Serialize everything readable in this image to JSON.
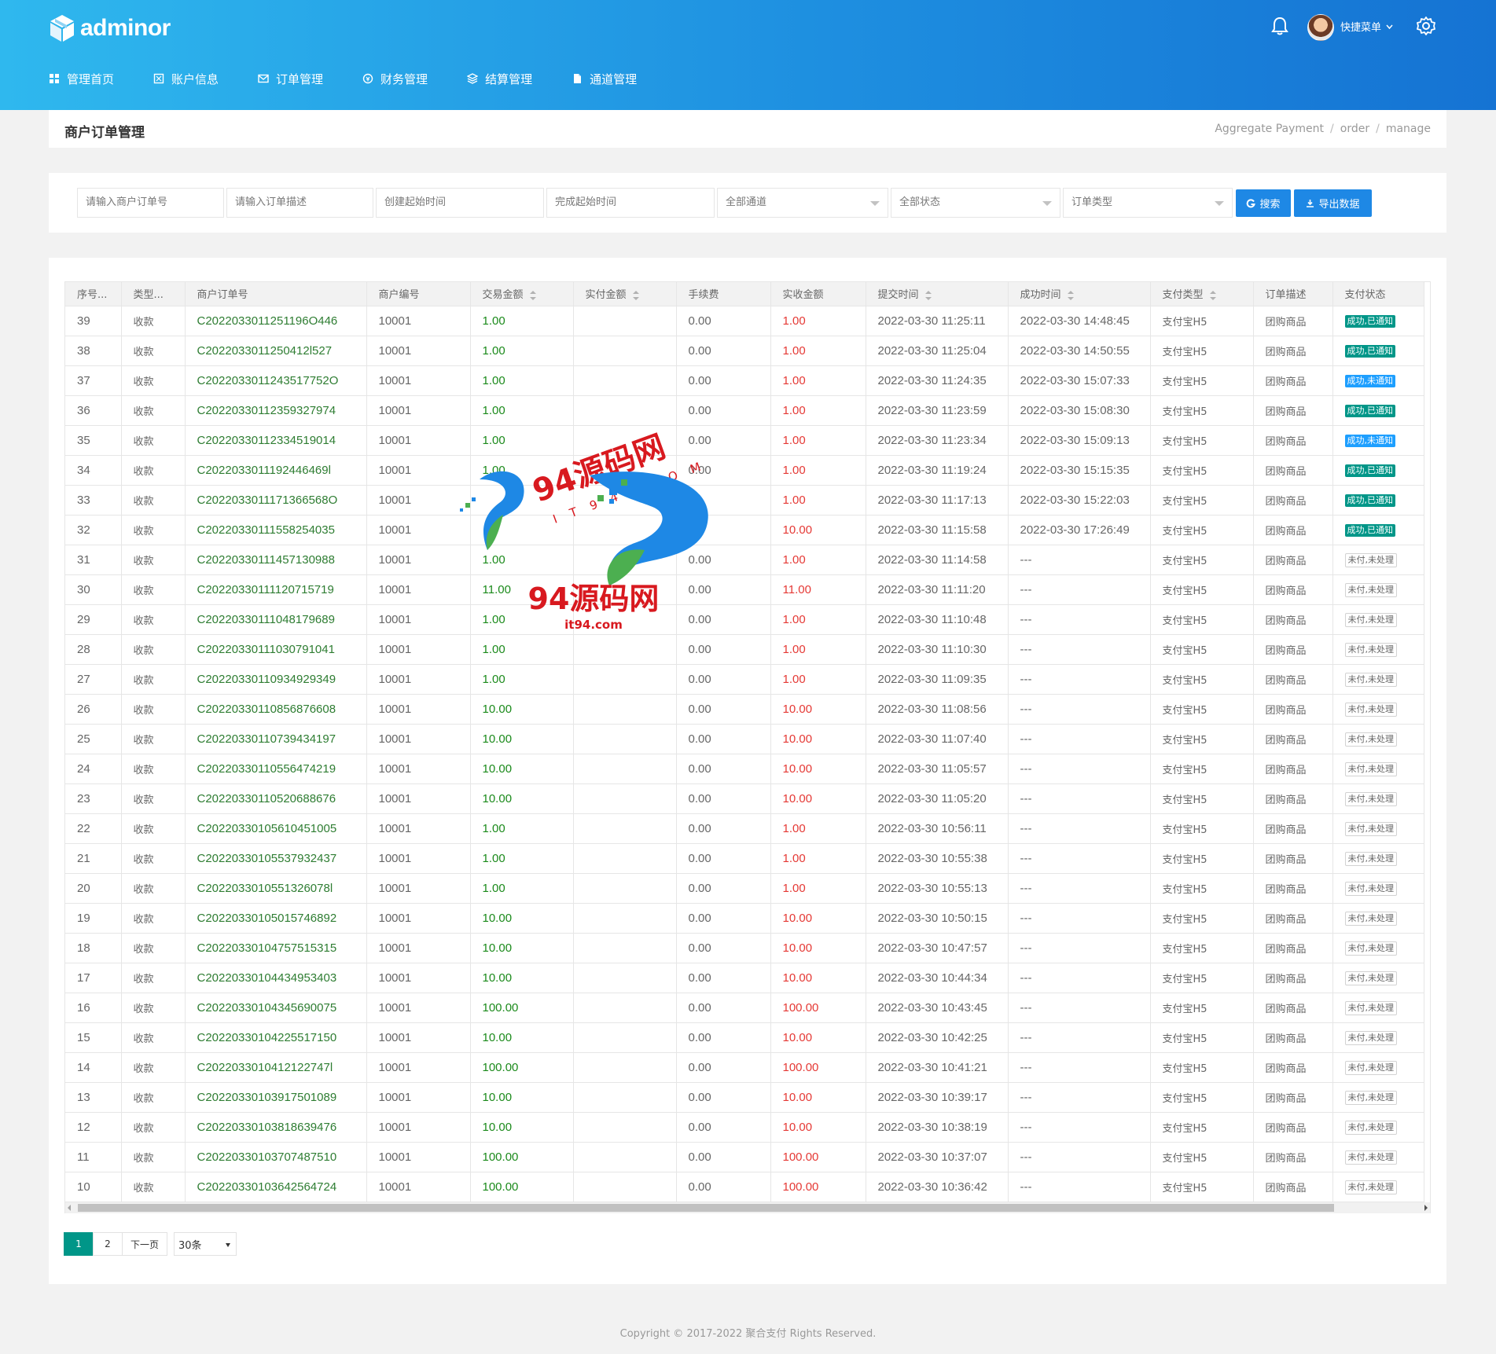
{
  "header": {
    "logo_text": "adminor",
    "quick_menu": "快捷菜单",
    "nav": [
      {
        "label": "管理首页",
        "icon": "grid-icon"
      },
      {
        "label": "账户信息",
        "icon": "account-icon"
      },
      {
        "label": "订单管理",
        "icon": "mail-icon"
      },
      {
        "label": "财务管理",
        "icon": "finance-icon"
      },
      {
        "label": "结算管理",
        "icon": "layers-icon"
      },
      {
        "label": "通道管理",
        "icon": "document-icon"
      }
    ]
  },
  "page": {
    "title": "商户订单管理",
    "breadcrumb": [
      "Aggregate Payment",
      "order",
      "manage"
    ]
  },
  "filters": {
    "order_no_placeholder": "请输入商户订单号",
    "desc_placeholder": "请输入订单描述",
    "create_time_placeholder": "创建起始时间",
    "finish_time_placeholder": "完成起始时间",
    "channel": "全部通道",
    "status": "全部状态",
    "order_type": "订单类型",
    "search_label": "搜索",
    "export_label": "导出数据"
  },
  "table": {
    "headers": [
      "序号...",
      "类型...",
      "商户订单号",
      "商户编号",
      "交易金额",
      "实付金额",
      "手续费",
      "实收金额",
      "提交时间",
      "成功时间",
      "支付类型",
      "订单描述",
      "支付状态"
    ],
    "rows": [
      {
        "id": "39",
        "type": "收款",
        "order": "C2022033011251196O446",
        "merchant": "10001",
        "amount": "1.00",
        "paid": "",
        "fee": "0.00",
        "received": "1.00",
        "submit": "2022-03-30 11:25:11",
        "success": "2022-03-30 14:48:45",
        "pay_type": "支付宝H5",
        "desc": "团购商品",
        "status": "成功,已通知",
        "st": "ok"
      },
      {
        "id": "38",
        "type": "收款",
        "order": "C2022033011250412l527",
        "merchant": "10001",
        "amount": "1.00",
        "paid": "",
        "fee": "0.00",
        "received": "1.00",
        "submit": "2022-03-30 11:25:04",
        "success": "2022-03-30 14:50:55",
        "pay_type": "支付宝H5",
        "desc": "团购商品",
        "status": "成功,已通知",
        "st": "ok"
      },
      {
        "id": "37",
        "type": "收款",
        "order": "C2022033011243517752O",
        "merchant": "10001",
        "amount": "1.00",
        "paid": "",
        "fee": "0.00",
        "received": "1.00",
        "submit": "2022-03-30 11:24:35",
        "success": "2022-03-30 15:07:33",
        "pay_type": "支付宝H5",
        "desc": "团购商品",
        "status": "成功,未通知",
        "st": "info"
      },
      {
        "id": "36",
        "type": "收款",
        "order": "C2022033011235932797​4",
        "merchant": "10001",
        "amount": "1.00",
        "paid": "",
        "fee": "0.00",
        "received": "1.00",
        "submit": "2022-03-30 11:23:59",
        "success": "2022-03-30 15:08:30",
        "pay_type": "支付宝H5",
        "desc": "团购商品",
        "status": "成功,已通知",
        "st": "ok"
      },
      {
        "id": "35",
        "type": "收款",
        "order": "C2022033011233451901​4",
        "merchant": "10001",
        "amount": "1.00",
        "paid": "",
        "fee": "0.00",
        "received": "1.00",
        "submit": "2022-03-30 11:23:34",
        "success": "2022-03-30 15:09:13",
        "pay_type": "支付宝H5",
        "desc": "团购商品",
        "status": "成功,未通知",
        "st": "info"
      },
      {
        "id": "34",
        "type": "收款",
        "order": "C2022033011192446469l",
        "merchant": "10001",
        "amount": "1.00",
        "paid": "",
        "fee": "0.00",
        "received": "1.00",
        "submit": "2022-03-30 11:19:24",
        "success": "2022-03-30 15:15:35",
        "pay_type": "支付宝H5",
        "desc": "团购商品",
        "status": "成功,已通知",
        "st": "ok"
      },
      {
        "id": "33",
        "type": "收款",
        "order": "C2022033011171366568O",
        "merchant": "10001",
        "amount": "",
        "paid": "",
        "fee": "",
        "received": "1.00",
        "submit": "2022-03-30 11:17:13",
        "success": "2022-03-30 15:22:03",
        "pay_type": "支付宝H5",
        "desc": "团购商品",
        "status": "成功,已通知",
        "st": "ok"
      },
      {
        "id": "32",
        "type": "收款",
        "order": "C2022033011155825403​5",
        "merchant": "10001",
        "amount": "",
        "paid": "",
        "fee": "",
        "received": "10.00",
        "submit": "2022-03-30 11:15:58",
        "success": "2022-03-30 17:26:49",
        "pay_type": "支付宝H5",
        "desc": "团购商品",
        "status": "成功,已通知",
        "st": "ok"
      },
      {
        "id": "31",
        "type": "收款",
        "order": "C2022033011145713098​8",
        "merchant": "10001",
        "amount": "1.00",
        "paid": "",
        "fee": "0.00",
        "received": "1.00",
        "submit": "2022-03-30 11:14:58",
        "success": "---",
        "pay_type": "支付宝H5",
        "desc": "团购商品",
        "status": "未付,未处理",
        "st": "pend"
      },
      {
        "id": "30",
        "type": "收款",
        "order": "C2022033011112071571​9",
        "merchant": "10001",
        "amount": "11.00",
        "paid": "",
        "fee": "0.00",
        "received": "11.00",
        "submit": "2022-03-30 11:11:20",
        "success": "---",
        "pay_type": "支付宝H5",
        "desc": "团购商品",
        "status": "未付,未处理",
        "st": "pend"
      },
      {
        "id": "29",
        "type": "收款",
        "order": "C2022033011104817968​9",
        "merchant": "10001",
        "amount": "1.00",
        "paid": "",
        "fee": "0.00",
        "received": "1.00",
        "submit": "2022-03-30 11:10:48",
        "success": "---",
        "pay_type": "支付宝H5",
        "desc": "团购商品",
        "status": "未付,未处理",
        "st": "pend"
      },
      {
        "id": "28",
        "type": "收款",
        "order": "C2022033011103079104​1",
        "merchant": "10001",
        "amount": "1.00",
        "paid": "",
        "fee": "0.00",
        "received": "1.00",
        "submit": "2022-03-30 11:10:30",
        "success": "---",
        "pay_type": "支付宝H5",
        "desc": "团购商品",
        "status": "未付,未处理",
        "st": "pend"
      },
      {
        "id": "27",
        "type": "收款",
        "order": "C2022033011093492934​9",
        "merchant": "10001",
        "amount": "1.00",
        "paid": "",
        "fee": "0.00",
        "received": "1.00",
        "submit": "2022-03-30 11:09:35",
        "success": "---",
        "pay_type": "支付宝H5",
        "desc": "团购商品",
        "status": "未付,未处理",
        "st": "pend"
      },
      {
        "id": "26",
        "type": "收款",
        "order": "C2022033011085687660​8",
        "merchant": "10001",
        "amount": "10.00",
        "paid": "",
        "fee": "0.00",
        "received": "10.00",
        "submit": "2022-03-30 11:08:56",
        "success": "---",
        "pay_type": "支付宝H5",
        "desc": "团购商品",
        "status": "未付,未处理",
        "st": "pend"
      },
      {
        "id": "25",
        "type": "收款",
        "order": "C2022033011073943419​7",
        "merchant": "10001",
        "amount": "10.00",
        "paid": "",
        "fee": "0.00",
        "received": "10.00",
        "submit": "2022-03-30 11:07:40",
        "success": "---",
        "pay_type": "支付宝H5",
        "desc": "团购商品",
        "status": "未付,未处理",
        "st": "pend"
      },
      {
        "id": "24",
        "type": "收款",
        "order": "C2022033011055647421​9",
        "merchant": "10001",
        "amount": "10.00",
        "paid": "",
        "fee": "0.00",
        "received": "10.00",
        "submit": "2022-03-30 11:05:57",
        "success": "---",
        "pay_type": "支付宝H5",
        "desc": "团购商品",
        "status": "未付,未处理",
        "st": "pend"
      },
      {
        "id": "23",
        "type": "收款",
        "order": "C2022033011052068867​6",
        "merchant": "10001",
        "amount": "10.00",
        "paid": "",
        "fee": "0.00",
        "received": "10.00",
        "submit": "2022-03-30 11:05:20",
        "success": "---",
        "pay_type": "支付宝H5",
        "desc": "团购商品",
        "status": "未付,未处理",
        "st": "pend"
      },
      {
        "id": "22",
        "type": "收款",
        "order": "C2022033010561045100​5",
        "merchant": "10001",
        "amount": "1.00",
        "paid": "",
        "fee": "0.00",
        "received": "1.00",
        "submit": "2022-03-30 10:56:11",
        "success": "---",
        "pay_type": "支付宝H5",
        "desc": "团购商品",
        "status": "未付,未处理",
        "st": "pend"
      },
      {
        "id": "21",
        "type": "收款",
        "order": "C2022033010553793243​7",
        "merchant": "10001",
        "amount": "1.00",
        "paid": "",
        "fee": "0.00",
        "received": "1.00",
        "submit": "2022-03-30 10:55:38",
        "success": "---",
        "pay_type": "支付宝H5",
        "desc": "团购商品",
        "status": "未付,未处理",
        "st": "pend"
      },
      {
        "id": "20",
        "type": "收款",
        "order": "C2022033010551326078l",
        "merchant": "10001",
        "amount": "1.00",
        "paid": "",
        "fee": "0.00",
        "received": "1.00",
        "submit": "2022-03-30 10:55:13",
        "success": "---",
        "pay_type": "支付宝H5",
        "desc": "团购商品",
        "status": "未付,未处理",
        "st": "pend"
      },
      {
        "id": "19",
        "type": "收款",
        "order": "C2022033010501574689​2",
        "merchant": "10001",
        "amount": "10.00",
        "paid": "",
        "fee": "0.00",
        "received": "10.00",
        "submit": "2022-03-30 10:50:15",
        "success": "---",
        "pay_type": "支付宝H5",
        "desc": "团购商品",
        "status": "未付,未处理",
        "st": "pend"
      },
      {
        "id": "18",
        "type": "收款",
        "order": "C2022033010475751531​5",
        "merchant": "10001",
        "amount": "10.00",
        "paid": "",
        "fee": "0.00",
        "received": "10.00",
        "submit": "2022-03-30 10:47:57",
        "success": "---",
        "pay_type": "支付宝H5",
        "desc": "团购商品",
        "status": "未付,未处理",
        "st": "pend"
      },
      {
        "id": "17",
        "type": "收款",
        "order": "C2022033010443495340​3",
        "merchant": "10001",
        "amount": "10.00",
        "paid": "",
        "fee": "0.00",
        "received": "10.00",
        "submit": "2022-03-30 10:44:34",
        "success": "---",
        "pay_type": "支付宝H5",
        "desc": "团购商品",
        "status": "未付,未处理",
        "st": "pend"
      },
      {
        "id": "16",
        "type": "收款",
        "order": "C2022033010434569007​5",
        "merchant": "10001",
        "amount": "100.00",
        "paid": "",
        "fee": "0.00",
        "received": "100.00",
        "submit": "2022-03-30 10:43:45",
        "success": "---",
        "pay_type": "支付宝H5",
        "desc": "团购商品",
        "status": "未付,未处理",
        "st": "pend"
      },
      {
        "id": "15",
        "type": "收款",
        "order": "C2022033010422551715​0",
        "merchant": "10001",
        "amount": "10.00",
        "paid": "",
        "fee": "0.00",
        "received": "10.00",
        "submit": "2022-03-30 10:42:25",
        "success": "---",
        "pay_type": "支付宝H5",
        "desc": "团购商品",
        "status": "未付,未处理",
        "st": "pend"
      },
      {
        "id": "14",
        "type": "收款",
        "order": "C2022033010412122747l",
        "merchant": "10001",
        "amount": "100.00",
        "paid": "",
        "fee": "0.00",
        "received": "100.00",
        "submit": "2022-03-30 10:41:21",
        "success": "---",
        "pay_type": "支付宝H5",
        "desc": "团购商品",
        "status": "未付,未处理",
        "st": "pend"
      },
      {
        "id": "13",
        "type": "收款",
        "order": "C2022033010391750108​9",
        "merchant": "10001",
        "amount": "10.00",
        "paid": "",
        "fee": "0.00",
        "received": "10.00",
        "submit": "2022-03-30 10:39:17",
        "success": "---",
        "pay_type": "支付宝H5",
        "desc": "团购商品",
        "status": "未付,未处理",
        "st": "pend"
      },
      {
        "id": "12",
        "type": "收款",
        "order": "C2022033010381863947​6",
        "merchant": "10001",
        "amount": "10.00",
        "paid": "",
        "fee": "0.00",
        "received": "10.00",
        "submit": "2022-03-30 10:38:19",
        "success": "---",
        "pay_type": "支付宝H5",
        "desc": "团购商品",
        "status": "未付,未处理",
        "st": "pend"
      },
      {
        "id": "11",
        "type": "收款",
        "order": "C2022033010370748751​0",
        "merchant": "10001",
        "amount": "100.00",
        "paid": "",
        "fee": "0.00",
        "received": "100.00",
        "submit": "2022-03-30 10:37:07",
        "success": "---",
        "pay_type": "支付宝H5",
        "desc": "团购商品",
        "status": "未付,未处理",
        "st": "pend"
      },
      {
        "id": "10",
        "type": "收款",
        "order": "C2022033010364256472​4",
        "merchant": "10001",
        "amount": "100.00",
        "paid": "",
        "fee": "0.00",
        "received": "100.00",
        "submit": "2022-03-30 10:36:42",
        "success": "---",
        "pay_type": "支付宝H5",
        "desc": "团购商品",
        "status": "未付,未处理",
        "st": "pend"
      }
    ]
  },
  "pager": {
    "pages": [
      "1",
      "2"
    ],
    "next": "下一页",
    "page_size": "30条"
  },
  "footer": "Copyright © 2017-2022 聚合支付 Rights Reserved.",
  "watermark": {
    "text_top": "94源码网",
    "text_mid": "IT94.COM",
    "text_bottom": "94源码网",
    "text_url": "it94.com"
  },
  "colors": {
    "header_start": "#2fb8ee",
    "header_end": "#1573d3",
    "primary_button": "#1e88e5",
    "status_ok": "#009688",
    "status_info": "#1e9fff",
    "amount_green": "#1b8a1b",
    "received_red": "#e53935"
  }
}
